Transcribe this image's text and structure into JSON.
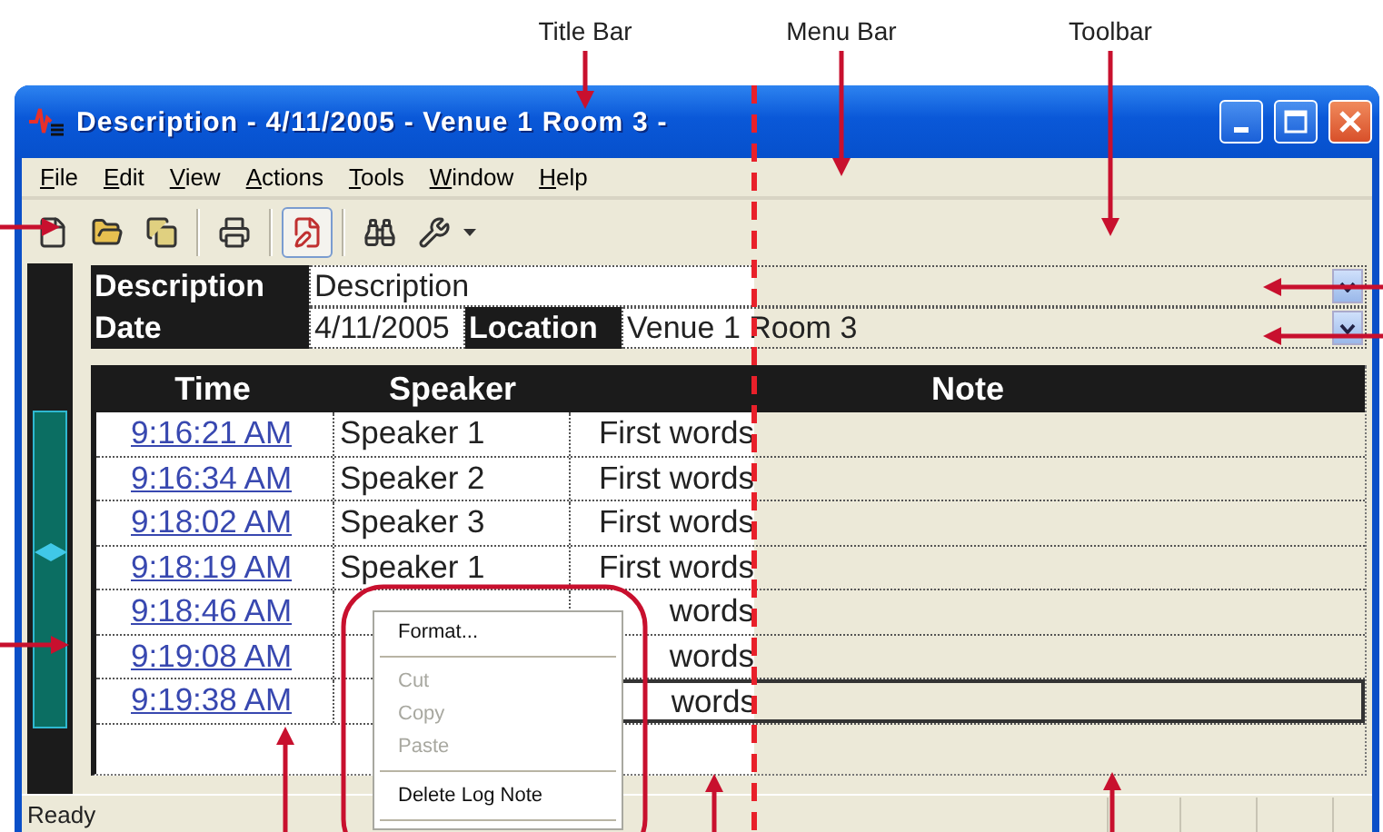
{
  "callouts": [
    "Title Bar",
    "Menu Bar",
    "Toolbar"
  ],
  "window": {
    "title": "Description - 4/11/2005 - Venue 1 Room 3 -"
  },
  "menu": [
    "File",
    "Edit",
    "View",
    "Actions",
    "Tools",
    "Window",
    "Help"
  ],
  "toolbar": [
    {
      "selected": false
    },
    {
      "selected": false
    },
    {
      "selected": false
    },
    {
      "selected": false
    },
    {
      "selected": true
    },
    {
      "selected": false
    },
    {
      "selected": false
    }
  ],
  "fields": {
    "description_label": "Description",
    "description_value": "Description",
    "date_label": "Date",
    "date_value": "4/11/2005",
    "location_label": "Location",
    "location_value": "Venue 1 Room 3"
  },
  "table": {
    "columns": [
      "Time",
      "Speaker",
      "Note"
    ],
    "rows": [
      {
        "time": "9:16:21 AM",
        "speaker": "Speaker 1",
        "note": "First words",
        "selected": false
      },
      {
        "time": "9:16:34 AM",
        "speaker": "Speaker 2",
        "note": "First words",
        "selected": false
      },
      {
        "time": "9:18:02 AM",
        "speaker": "Speaker 3",
        "note": "First words",
        "selected": false
      },
      {
        "time": "9:18:19 AM",
        "speaker": "Speaker 1",
        "note": "First words",
        "selected": false
      },
      {
        "time": "9:18:46 AM",
        "note": "words",
        "selected": false
      },
      {
        "time": "9:19:08 AM",
        "note": "words",
        "selected": false
      },
      {
        "time": "9:19:38 AM",
        "note": "words",
        "selected": true
      }
    ]
  },
  "context_menu": [
    {
      "kind": "item",
      "label": "Format...",
      "disabled": false
    },
    {
      "kind": "separator"
    },
    {
      "kind": "item",
      "label": "Cut",
      "disabled": true
    },
    {
      "kind": "item",
      "label": "Copy",
      "disabled": true
    },
    {
      "kind": "item",
      "label": "Paste",
      "disabled": true
    },
    {
      "kind": "separator"
    },
    {
      "kind": "item",
      "label": "Delete Log Note",
      "disabled": false
    },
    {
      "kind": "separator"
    }
  ],
  "status_bar": {
    "text": "Ready"
  }
}
